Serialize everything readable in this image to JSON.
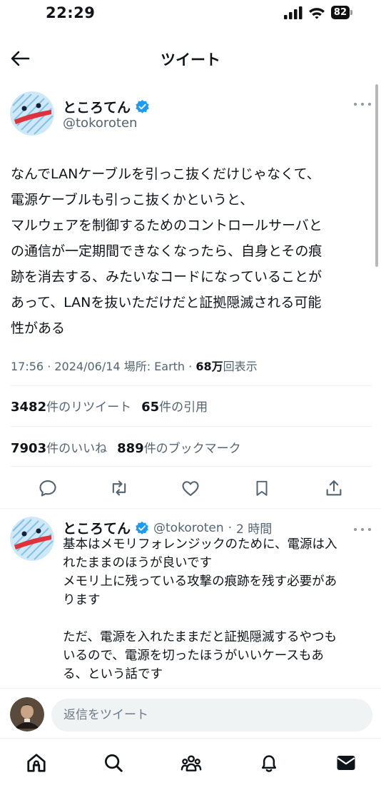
{
  "status_bar": {
    "time": "22:29",
    "battery": "82"
  },
  "header": {
    "title": "ツイート"
  },
  "tweet": {
    "author_name": "ところてん",
    "author_handle": "@tokoroten",
    "lines": [
      "なんでLANケーブルを引っこ抜くだけじゃなくて、",
      "電源ケーブルも引っこ抜くかというと、",
      "マルウェアを制御するためのコントロールサーバと",
      "の通信が一定期間できなくなったら、自身とその痕",
      "跡を消去する、みたいなコードになっていることが",
      "あって、LANを抜いただけだと証拠隠滅される可能",
      "性がある"
    ],
    "time": "17:56",
    "date": "2024/06/14",
    "location": "場所: Earth",
    "views_value": "68万",
    "views_label": "回表示",
    "retweets_count": "3482",
    "retweets_label": "件のリツイート",
    "quotes_count": "65",
    "quotes_label": "件の引用",
    "likes_count": "7903",
    "likes_label": "件のいいね",
    "bookmarks_count": "889",
    "bookmarks_label": "件のブックマーク"
  },
  "reply": {
    "author_name": "ところてん",
    "author_handle": "@tokoroten",
    "age": "2 時間",
    "lines": [
      "基本はメモリフォレンジックのために、電源は入",
      "れたままのほうが良いです",
      "メモリ上に残っている攻撃の痕跡を残す必要があ",
      "ります",
      "",
      "ただ、電源を入れたままだと証拠隠滅するやつも",
      "いるので、電源を切ったほうがいいケースもあ",
      "る、という話です"
    ]
  },
  "reply_bar": {
    "placeholder": "返信をツイート"
  },
  "colors": {
    "accent": "#1d9bf0",
    "secondary_text": "#536471",
    "divider": "#eff3f4"
  },
  "icons": {
    "nav": [
      "home-icon",
      "search-icon",
      "communities-icon",
      "notifications-icon",
      "messages-icon"
    ],
    "actions": [
      "reply-icon",
      "retweet-icon",
      "like-icon",
      "bookmark-icon",
      "share-icon"
    ]
  }
}
